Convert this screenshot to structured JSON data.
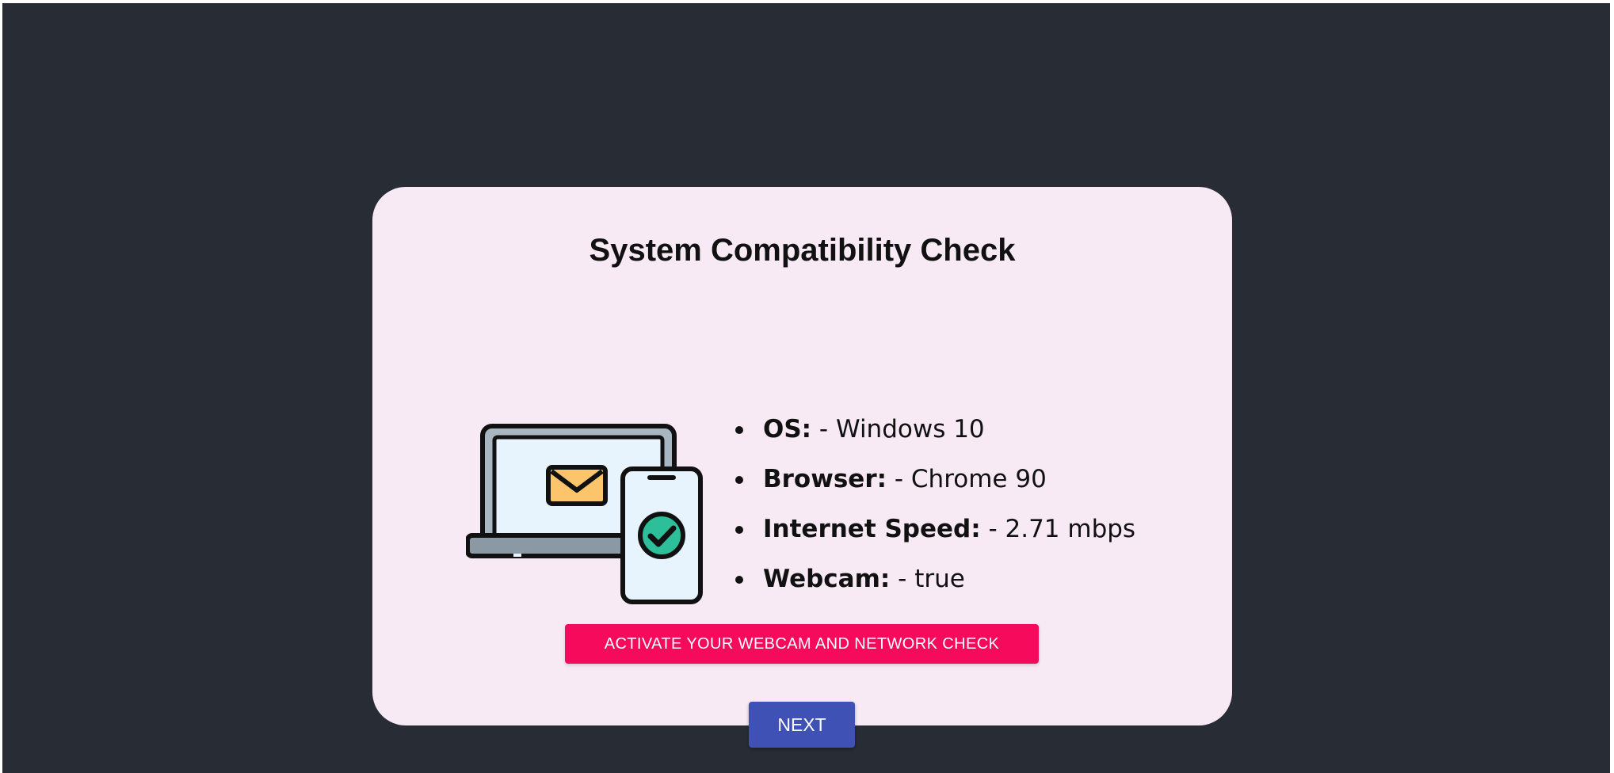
{
  "card": {
    "title": "System Compatibility Check"
  },
  "specs": [
    {
      "key": "OS:",
      "value": " - Windows 10"
    },
    {
      "key": "Browser:",
      "value": " - Chrome 90"
    },
    {
      "key": "Internet Speed:",
      "value": " - 2.71 mbps"
    },
    {
      "key": "Webcam:",
      "value": " - true"
    }
  ],
  "actions": {
    "activate_label": "ACTIVATE YOUR WEBCAM AND NETWORK CHECK",
    "next_label": "NEXT"
  },
  "illustration": {
    "icons": [
      "laptop-icon",
      "mail-icon",
      "smartphone-icon",
      "check-circle-icon"
    ]
  },
  "colors": {
    "background": "#282c35",
    "card": "#f7eaf5",
    "activate_button": "#f50a5c",
    "next_button": "#3f51b5",
    "check_green": "#2cbf9a",
    "mail_orange": "#fcc56b",
    "screen_blue": "#e7f4fd"
  }
}
